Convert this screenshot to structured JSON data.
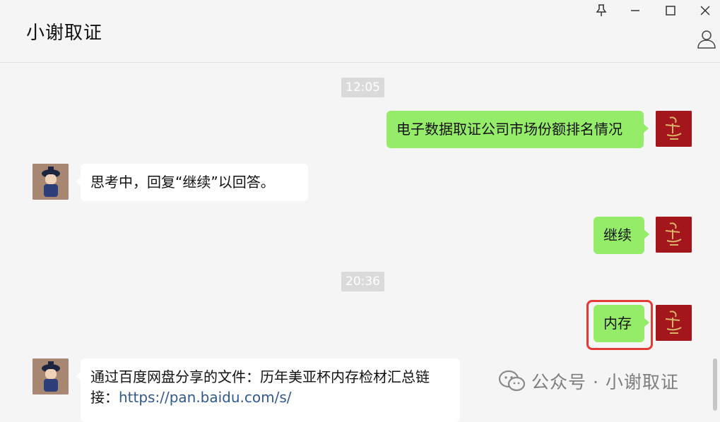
{
  "window": {
    "title": "小谢取证"
  },
  "theme": {
    "background": "#f5f5f5",
    "bubble_self": "#95ec69",
    "bubble_peer": "#ffffff",
    "highlight": "#e53935",
    "link": "#2f5a8b"
  },
  "controls": {
    "icons": [
      "pin-icon",
      "minimize-icon",
      "maximize-icon",
      "close-icon",
      "profile-icon"
    ]
  },
  "messages": {
    "time1": "12:05",
    "msg1": "电子数据取证公司市场份额排名情况",
    "msg2": "思考中，回复“继续”以回答。",
    "msg3": "继续",
    "time2": "20:36",
    "msg4": "内存",
    "msg5_text": "通过百度网盘分享的文件：历年美亚杯内存检材汇总链接：",
    "msg5_link": "https://pan.baidu.com/s/"
  },
  "watermark": {
    "text": "公众号 · 小谢取证"
  }
}
